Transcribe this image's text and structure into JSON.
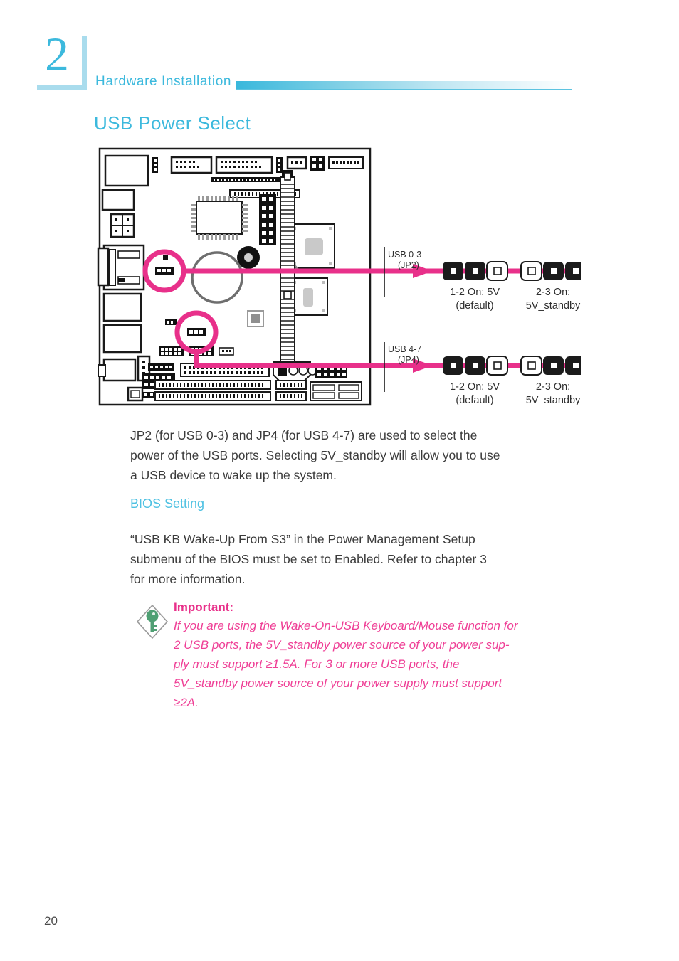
{
  "chapter": {
    "number": "2",
    "title": "Hardware Installation"
  },
  "page": {
    "number": "20"
  },
  "section": {
    "title": "USB Power Select"
  },
  "paragraphs": {
    "intro_line1": "JP2 (for USB 0-3) and JP4 (for USB 4-7) are used to select the",
    "intro_line2": "power of the USB ports. Selecting 5V_standby will allow you to use",
    "intro_line3": "a USB device to wake up the system."
  },
  "bios": {
    "title": "BIOS Setting",
    "line1": "“USB KB Wake-Up From S3” in the Power Management Setup",
    "line2": "submenu of the BIOS must be set to Enabled. Refer to chapter 3",
    "line3": "for more information."
  },
  "note": {
    "icon": "key-diamond-icon",
    "title": "Important:",
    "line1": "If you are using the Wake-On-USB Keyboard/Mouse function for",
    "line2": "2 USB ports, the 5V_standby power source of your power sup-",
    "line3": "ply must support ≥1.5A. For 3 or more USB ports, the",
    "line4": "5V_standby power source of your power supply must support",
    "line5": "≥2A."
  },
  "diagram": {
    "callouts": [
      {
        "id": "jp2",
        "label_line1": "USB 0-3",
        "label_line2": "(JP2)",
        "options": [
          {
            "state": "1-2",
            "caption_line1": "1-2  On: 5V",
            "caption_line2": "(default)",
            "pins": [
              "on",
              "on",
              "off"
            ]
          },
          {
            "state": "2-3",
            "caption_line1": "2-3  On:",
            "caption_line2": "5V_standby",
            "pins": [
              "off",
              "on",
              "on"
            ]
          }
        ]
      },
      {
        "id": "jp4",
        "label_line1": "USB 4-7",
        "label_line2": "(JP4)",
        "options": [
          {
            "state": "1-2",
            "caption_line1": "1-2  On: 5V",
            "caption_line2": "(default)",
            "pins": [
              "on",
              "on",
              "off"
            ]
          },
          {
            "state": "2-3",
            "caption_line1": "2-3  On:",
            "caption_line2": "5V_standby",
            "pins": [
              "off",
              "on",
              "on"
            ]
          }
        ]
      }
    ]
  },
  "colors": {
    "accent_blue": "#3cb9dd",
    "accent_magenta": "#e8308a",
    "note_pink": "#ef3f96",
    "body_text": "#3b3b3b",
    "board_outline": "#1a1a1a",
    "key_green": "#4f9f73"
  }
}
